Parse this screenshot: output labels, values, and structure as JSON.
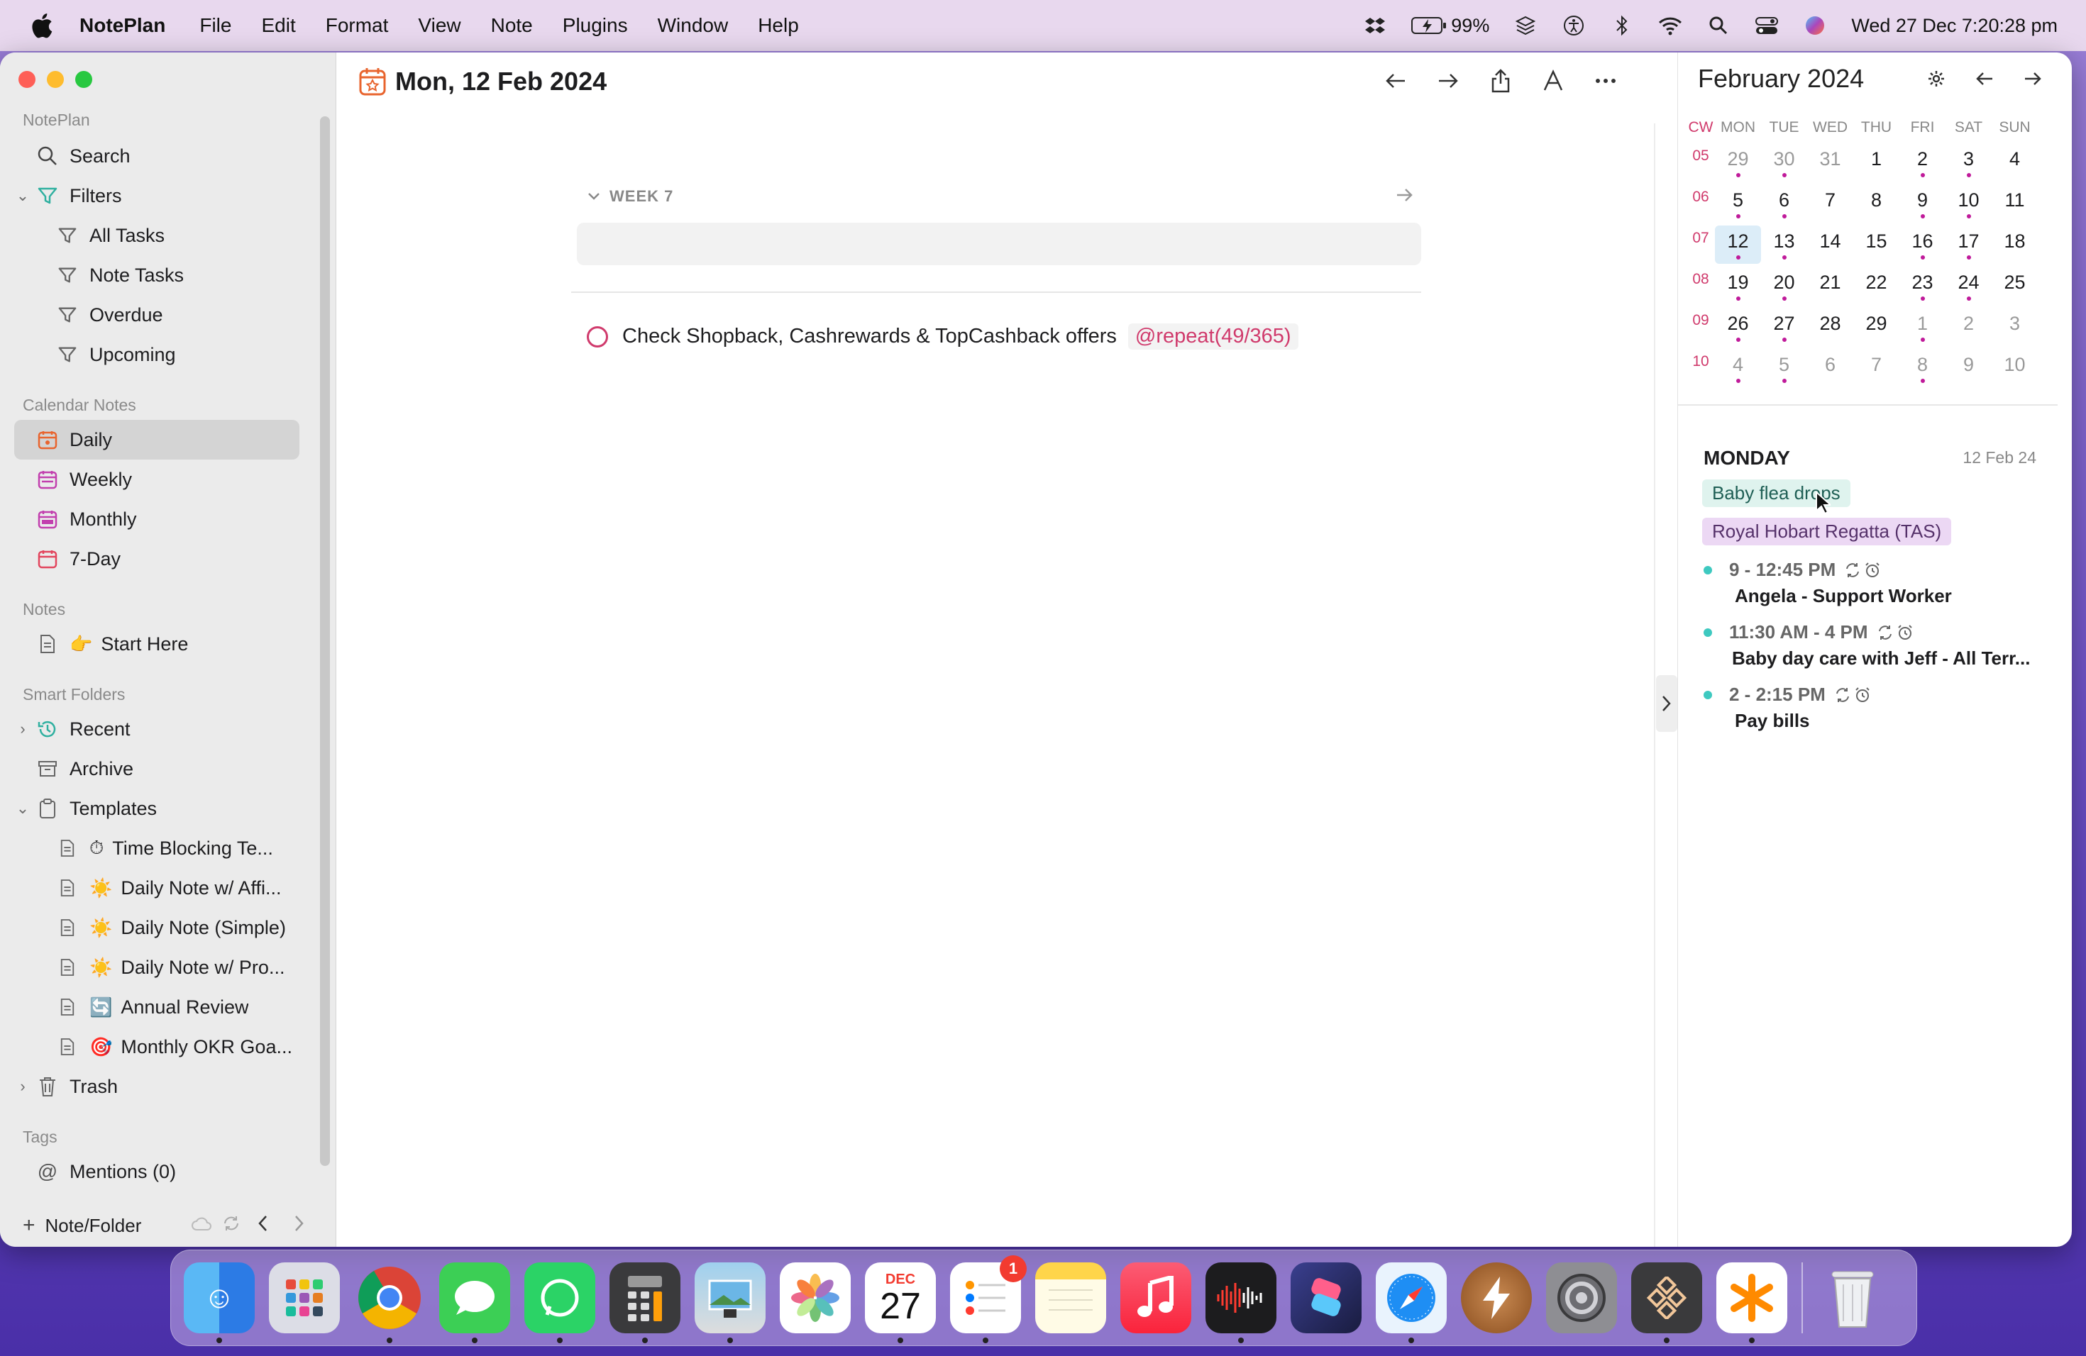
{
  "menubar": {
    "app_name": "NotePlan",
    "items": [
      "File",
      "Edit",
      "Format",
      "View",
      "Note",
      "Plugins",
      "Window",
      "Help"
    ],
    "battery": "99%",
    "datetime": "Wed 27 Dec  7:20:28 pm"
  },
  "sidebar": {
    "section_noteplan": "NotePlan",
    "search": "Search",
    "filters": "Filters",
    "filter_items": [
      "All Tasks",
      "Note Tasks",
      "Overdue",
      "Upcoming"
    ],
    "section_calendar": "Calendar Notes",
    "calendar_items": [
      "Daily",
      "Weekly",
      "Monthly",
      "7-Day"
    ],
    "section_notes": "Notes",
    "start_here": "Start Here",
    "section_smart": "Smart Folders",
    "recent": "Recent",
    "archive": "Archive",
    "templates": "Templates",
    "template_items": [
      "Time Blocking Te...",
      "Daily Note w/ Affi...",
      "Daily Note (Simple)",
      "Daily Note w/ Pro...",
      "Annual Review",
      "Monthly OKR Goa..."
    ],
    "trash": "Trash",
    "section_tags": "Tags",
    "mentions": "Mentions (0)",
    "new_note": "Note/Folder"
  },
  "editor": {
    "title": "Mon, 12 Feb 2024",
    "week_label": "WEEK 7",
    "task_text": "Check Shopback, Cashrewards & TopCashback offers",
    "task_tag": "@repeat(49/365)"
  },
  "calendar": {
    "title": "February 2024",
    "headers": [
      "CW",
      "MON",
      "TUE",
      "WED",
      "THU",
      "FRI",
      "SAT",
      "SUN"
    ],
    "weeks": [
      {
        "cw": "05",
        "days": [
          "29",
          "30",
          "31",
          "1",
          "2",
          "3",
          "4"
        ]
      },
      {
        "cw": "06",
        "days": [
          "5",
          "6",
          "7",
          "8",
          "9",
          "10",
          "11"
        ]
      },
      {
        "cw": "07",
        "days": [
          "12",
          "13",
          "14",
          "15",
          "16",
          "17",
          "18"
        ]
      },
      {
        "cw": "08",
        "days": [
          "19",
          "20",
          "21",
          "22",
          "23",
          "24",
          "25"
        ]
      },
      {
        "cw": "09",
        "days": [
          "26",
          "27",
          "28",
          "29",
          "1",
          "2",
          "3"
        ]
      },
      {
        "cw": "10",
        "days": [
          "4",
          "5",
          "6",
          "7",
          "8",
          "9",
          "10"
        ]
      }
    ],
    "day_header": "MONDAY",
    "day_date": "12 Feb 24",
    "chips": [
      "Baby flea drops",
      "Royal Hobart Regatta (TAS)"
    ],
    "events": [
      {
        "time": "9 - 12:45 PM",
        "name": "Angela - Support Worker"
      },
      {
        "time": "11:30 AM - 4 PM",
        "name": "Baby day care with Jeff - All Terr..."
      },
      {
        "time": "2 - 2:15 PM",
        "name": "Pay bills"
      }
    ]
  },
  "dock": {
    "calendar_month": "DEC",
    "calendar_day": "27",
    "reminders_badge": "1"
  },
  "colors": {
    "accent": "#d03a6c",
    "today_bg": "#dcedf8",
    "event_bullet": "#3ec9c0"
  }
}
